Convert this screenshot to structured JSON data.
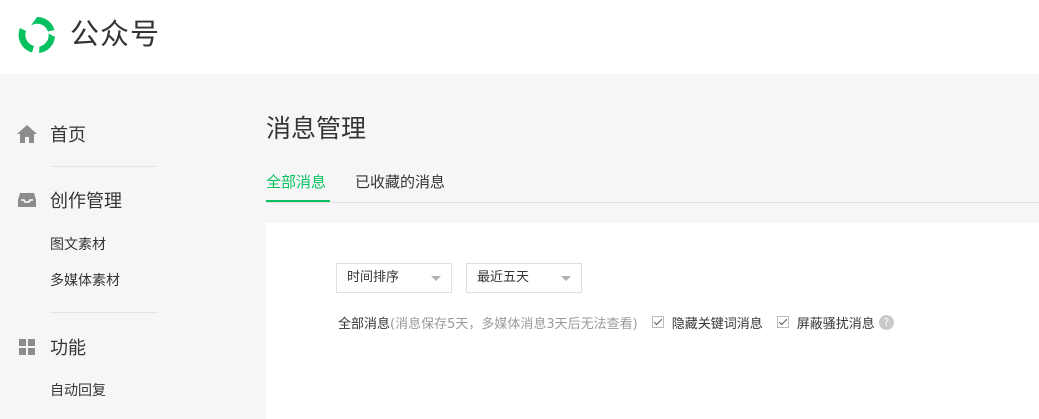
{
  "brand": {
    "name": "公众号"
  },
  "sidebar": {
    "home": {
      "label": "首页",
      "icon": "home-icon"
    },
    "creation": {
      "label": "创作管理",
      "icon": "inbox-icon",
      "items": [
        "图文素材",
        "多媒体素材"
      ]
    },
    "features": {
      "label": "功能",
      "icon": "grid-icon",
      "items": [
        "自动回复"
      ]
    }
  },
  "main": {
    "title": "消息管理",
    "tabs": [
      {
        "label": "全部消息",
        "active": true
      },
      {
        "label": "已收藏的消息",
        "active": false
      }
    ],
    "filters": {
      "sort": "时间排序",
      "range": "最近五天",
      "scope_label": "全部消息",
      "scope_note": "(消息保存5天，多媒体消息3天后无法查看)",
      "hide_keyword": {
        "label": "隐藏关键词消息",
        "checked": true
      },
      "block_spam": {
        "label": "屏蔽骚扰消息",
        "checked": true
      },
      "help_glyph": "?"
    }
  },
  "colors": {
    "accent": "#07c160",
    "background": "#f6f6f6",
    "panel": "#ffffff"
  }
}
